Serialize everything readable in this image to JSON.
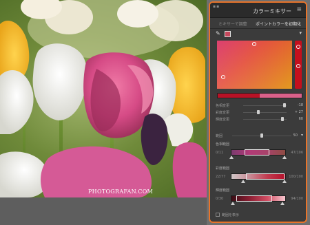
{
  "photo": {
    "watermark": "PHOTOGRAFAN.COM"
  },
  "panel": {
    "title": "カラーミキサー",
    "tabs": [
      "ミキサーで調整",
      "ポイントカラーを初期化"
    ],
    "accent_color": "#e8742a",
    "selected_color": "#c7475b",
    "sliders": [
      {
        "label": "色相変更",
        "value": "-18"
      },
      {
        "label": "彩度変更",
        "value": "+ 27"
      },
      {
        "label": "輝度変更",
        "value": "60"
      }
    ],
    "range": {
      "label": "範囲",
      "value": "50"
    },
    "hue_range": {
      "heading": "色相範囲",
      "low": "0/11",
      "high": "47/106"
    },
    "sat_range": {
      "heading": "彩度範囲",
      "low": "22/77",
      "high": "100/100"
    },
    "lum_range": {
      "heading": "輝度範囲",
      "low": "0/30",
      "high": "94/100"
    },
    "show_range_label": "範囲を表示"
  },
  "icons": {
    "menu": "hamburger-icon",
    "eyedropper": "eyedropper-icon",
    "chevron": "chevron-down-icon"
  }
}
